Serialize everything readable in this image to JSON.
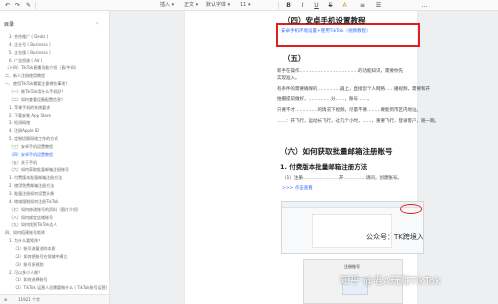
{
  "toolbar": {
    "insert": "插入 ▾",
    "body_text": "正文 ▾",
    "font": "默认字体 ▾",
    "font_size": "11 ▾",
    "bold": "B",
    "italic": "I",
    "underline": "U",
    "strike": "S",
    "color": "A",
    "align": "≡",
    "list": "☰",
    "more": "…"
  },
  "sidebar": {
    "heading": "目录",
    "items": [
      {
        "label": "3. 合作推广 ( Dealz )",
        "level": 1
      },
      {
        "label": "4. 企业号 ( Business )",
        "level": 1
      },
      {
        "label": "5. 企业版 ( Business )",
        "level": 1
      },
      {
        "label": "6. 广告投放 ( Ad )",
        "level": 1
      },
      {
        "label": "（十四）TikTok直播功能介绍（直/中间）",
        "level": 0
      },
      {
        "label": "二、新人注册使用教程",
        "level": 0
      },
      {
        "label": "一、使用TikTok需要注意哪些事项？",
        "level": 0
      },
      {
        "label": "（一）做TikTok用什么手机好？",
        "level": 1
      },
      {
        "label": "（二）如何查看设备配置信息？",
        "level": 1
      },
      {
        "label": "1. 苹果手机的系统要求",
        "level": 1
      },
      {
        "label": "2. 下载安装 App Store",
        "level": 1
      },
      {
        "label": "3. 检测网络",
        "level": 1
      },
      {
        "label": "4. 注册Apple ID",
        "level": 1
      },
      {
        "label": "5. 定制切换网络工作的方式",
        "level": 1
      },
      {
        "label": "（三）安卓手机设置教程",
        "level": 1
      },
      {
        "label": "（四）安卓手机设置教程",
        "level": 1,
        "active": true
      },
      {
        "label": "（五）关于手机",
        "level": 1
      },
      {
        "label": "（六）如何获取批量邮箱注册账号",
        "level": 1
      },
      {
        "label": "1. 付费版本批量邮箱注册方法",
        "level": 1
      },
      {
        "label": "2. 使用免费邮箱注册方法",
        "level": 1
      },
      {
        "label": "3. 批量注册如何设置头像",
        "level": 1
      },
      {
        "label": "4. 地域限制如何注册TikTok",
        "level": 1
      },
      {
        "label": "（七）如何修改账号的资料（图片介绍）",
        "level": 1
      },
      {
        "label": "（八）如何绑定店铺账号",
        "level": 1
      },
      {
        "label": "（九）如何找到TikTok达人",
        "level": 1
      },
      {
        "label": "四、如何搭建账号矩阵",
        "level": 0
      },
      {
        "label": "1. 为什么要矩阵？",
        "level": 1
      },
      {
        "label": "（1）账号流量池的本质",
        "level": 2
      },
      {
        "label": "（2）如何把账号在领域中建立",
        "level": 2
      },
      {
        "label": "（3）账号多规划",
        "level": 2
      },
      {
        "label": "2. 可以多少人做？",
        "level": 1
      },
      {
        "label": "（1）如何选择账号",
        "level": 2
      },
      {
        "label": "（2）TikTok 运营人员需要做什么 ( TikTok账号运营)",
        "level": 2
      }
    ],
    "bottom_left": "⊞",
    "bottom_label": "11921 个字"
  },
  "document": {
    "sec4_title": "（四）安卓手机设置教程",
    "sec4_link": "安卓手机环境设置+使用TikTok（视频教程）",
    "sec5_title": "（五）",
    "sec5_lines": [
      "新手在操作…………………………………的功能知识，需要你先",
      "实现准入。",
      "有条件的需要确保的……………器上，直接您个人网络……播视频，需要和开",
      "拍摄提前做好，……………分……，账号……，",
      "只要不才……………的情况下视频，尽量不要………要能到市区内地址。",
      "……：开飞行，运动长飞行，过几个小时，……，重要飞行，登录客户，随一期。"
    ],
    "sec6_title": "（六）如何获取批量邮箱注册账号",
    "sub1_title": "1. 付费版本批量邮箱注册方法",
    "sub1_line": "（1）注册……………………开……………请同，创建账号。",
    "sub1_link": ">>> 点击查看",
    "shot_watermark": "公众号：TK跨境入门",
    "shot2_title": "注册账号"
  },
  "watermark": "知乎 @老A玩赚TikTok",
  "colors": {
    "accent": "#2f6df6",
    "highlight": "#e01f1f"
  }
}
